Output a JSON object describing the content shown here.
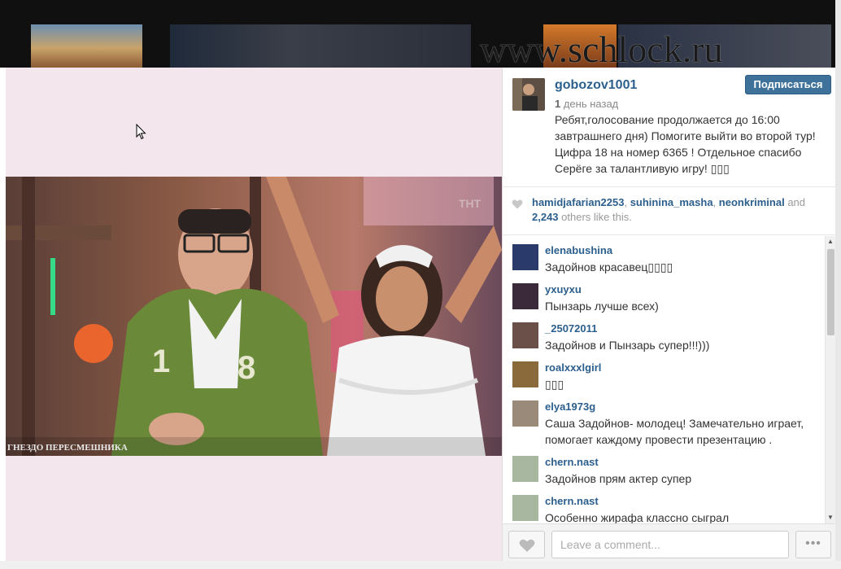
{
  "watermark": "www.schlock.ru",
  "video": {
    "channel_logo": "ТНТ",
    "show_caption": "ГНЕЗДО ПЕРЕСМЕШНИКА"
  },
  "post": {
    "username": "gobozov1001",
    "follow_label": "Подписаться",
    "time_number": "1",
    "time_rest": " день назад",
    "caption": "Ребят,голосование продолжается до 16:00 завтрашнего дня) Помогите выйти во второй тур! Цифра 18 на номер 6365 ! Отдельное спасибо Серёге за талантливую игру! ▯▯▯"
  },
  "likes": {
    "user1": "hamidjafarian2253",
    "sep1": ", ",
    "user2": "suhinina_masha",
    "sep2": ", ",
    "user3": "neonkriminal",
    "and_text": " and ",
    "count": "2,243",
    "tail": " others like this."
  },
  "comments": [
    {
      "user": "elenabushina",
      "text": "Задойнов красавец▯▯▯▯"
    },
    {
      "user": "yxuyxu",
      "text": "Пынзарь лучше всех)"
    },
    {
      "user": "_25072011",
      "text": "Задойнов и Пынзарь супер!!!)))"
    },
    {
      "user": "roalxxxlgirl",
      "text": "▯▯▯"
    },
    {
      "user": "elya1973g",
      "text": "Саша Задойнов- молодец! Замечательно играет, помогает каждому провести презентацию ."
    },
    {
      "user": "chern.nast",
      "text": "Задойнов прям актер супер"
    },
    {
      "user": "chern.nast",
      "text": "Особенно жирафа классно сыграл"
    }
  ],
  "comment_input": {
    "placeholder": "Leave a comment..."
  },
  "more_label": "•••",
  "icons": {
    "heart": "heart-icon",
    "more": "more-dots-icon",
    "cursor": "mouse-cursor-icon"
  },
  "colors": {
    "link": "#2c5f8d",
    "follow_button": "#3f729b",
    "media_background": "#f3e6ec"
  }
}
